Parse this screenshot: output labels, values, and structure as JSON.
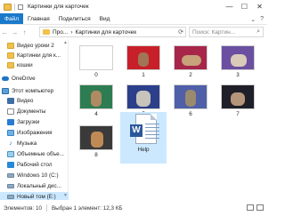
{
  "window": {
    "title": "Картинки для карточек",
    "minimize": "—",
    "maximize": "☐",
    "close": "✕"
  },
  "ribbon": {
    "tabs": [
      "Файл",
      "Главная",
      "Поделиться",
      "Вид"
    ]
  },
  "address": {
    "back": "←",
    "forward": "→",
    "up": "↑",
    "path": [
      "Про...",
      "Картинки для карточек"
    ],
    "search_placeholder": "Поиск: Картин...",
    "search_icon": "search-icon"
  },
  "nav": {
    "items": [
      {
        "label": "Видео уроки 2",
        "icon": "folder"
      },
      {
        "label": "Картинки для к...",
        "icon": "folder"
      },
      {
        "label": "кошки",
        "icon": "folder"
      },
      {
        "label": "OneDrive",
        "icon": "cloud"
      },
      {
        "label": "Этот компьютер",
        "icon": "pc"
      },
      {
        "label": "Видео",
        "icon": "video"
      },
      {
        "label": "Документы",
        "icon": "doc"
      },
      {
        "label": "Загрузки",
        "icon": "down"
      },
      {
        "label": "Изображения",
        "icon": "img"
      },
      {
        "label": "Музыка",
        "icon": "music"
      },
      {
        "label": "Объемные объе...",
        "icon": "3d"
      },
      {
        "label": "Рабочий стол",
        "icon": "desk"
      },
      {
        "label": "Windows 10 (C:)",
        "icon": "drive"
      },
      {
        "label": "Локальный дис...",
        "icon": "drive"
      },
      {
        "label": "Новый том (E:)",
        "icon": "drive"
      }
    ]
  },
  "files": [
    {
      "label": "0",
      "bg": "#ffffff"
    },
    {
      "label": "1",
      "bg": "#c8202a"
    },
    {
      "label": "2",
      "bg": "#a7264a"
    },
    {
      "label": "3",
      "bg": "#6b4fa0"
    },
    {
      "label": "4",
      "bg": "#2e7d52"
    },
    {
      "label": "5",
      "bg": "#2b3f8a"
    },
    {
      "label": "6",
      "bg": "#4f5fa8"
    },
    {
      "label": "7",
      "bg": "#1f1f2a"
    },
    {
      "label": "8",
      "bg": "#3a3a3a"
    },
    {
      "label": "Help",
      "bg": "none"
    }
  ],
  "status": {
    "elements": "Элементов: 10",
    "selected": "Выбран 1 элемент: 12,3 КБ"
  }
}
